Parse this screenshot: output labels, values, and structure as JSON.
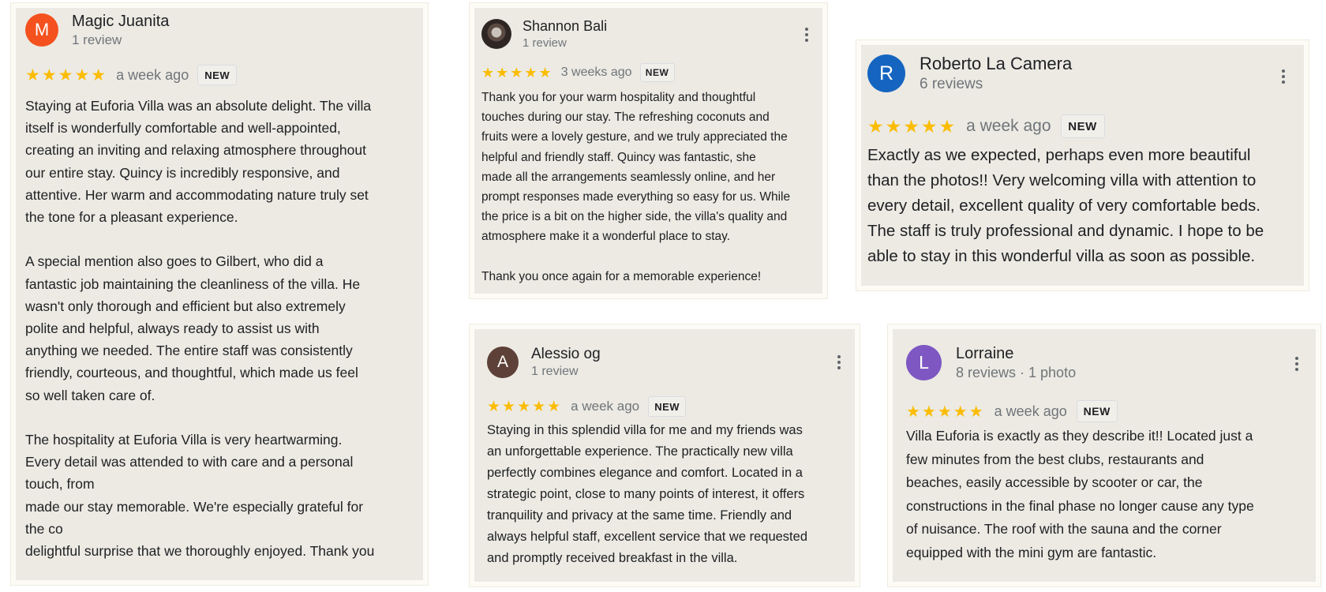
{
  "colors": {
    "card_bg": "#eceae3",
    "star": "#fbbc04",
    "meta_text": "#70757a",
    "avatar_magic": "#f4511e",
    "avatar_roberto": "#1565c0",
    "avatar_alessio": "#5d4037",
    "avatar_lorraine": "#7e57c2"
  },
  "reviews": [
    {
      "avatar_letter": "M",
      "name": "Magic Juanita",
      "meta": "1 review",
      "rating": 5,
      "stars": "★★★★★",
      "time": "a week ago",
      "badge": "NEW",
      "text": "Staying at Euforia Villa was an absolute delight. The villa\nitself is wonderfully comfortable and well-appointed,\ncreating an inviting and relaxing atmosphere throughout\nour entire stay. Quincy is incredibly responsive, and\nattentive. Her warm and accommodating nature truly set\nthe tone for a pleasant experience.\n\nA special mention also goes to Gilbert, who did a\nfantastic job maintaining the cleanliness of the villa. He\nwasn't only thorough and efficient but also extremely\npolite and helpful, always ready to assist us with\nanything we needed. The entire staff was consistently\nfriendly, courteous, and thoughtful, which made us feel\nso well taken care of.\n\nThe hospitality at Euforia Villa is very heartwarming.\nEvery detail was attended to with care and a personal\ntouch, from\nmade our stay memorable. We're especially grateful for\nthe co\ndelightful surprise that we thoroughly enjoyed. Thank you"
    },
    {
      "avatar_icon": "profile-photo",
      "name": "Shannon Bali",
      "meta": "1 review",
      "rating": 5,
      "stars": "★★★★★",
      "time": "3 weeks ago",
      "badge": "NEW",
      "text": "Thank you for your warm hospitality and thoughtful\ntouches during our stay. The refreshing coconuts and\nfruits were a lovely gesture, and we truly appreciated the\nhelpful and friendly staff. Quincy was fantastic, she\nmade all the arrangements seamlessly online, and her\nprompt responses made everything so easy for us. While\nthe price is a bit on the higher side, the villa's quality and\natmosphere make it a wonderful place to stay.\n\nThank you once again for a memorable experience!"
    },
    {
      "avatar_letter": "R",
      "name": "Roberto La Camera",
      "meta": "6 reviews",
      "rating": 5,
      "stars": "★★★★★",
      "time": "a week ago",
      "badge": "NEW",
      "text": "Exactly as we expected, perhaps even more beautiful\nthan the photos!! Very welcoming villa with attention to\nevery detail, excellent quality of very comfortable beds.\nThe staff is truly professional and dynamic. I hope to be\nable to stay in this wonderful villa as soon as possible."
    },
    {
      "avatar_letter": "A",
      "name": "Alessio og",
      "meta": "1 review",
      "rating": 5,
      "stars": "★★★★★",
      "time": "a week ago",
      "badge": "NEW",
      "text": "Staying in this splendid villa for me and my friends was\nan unforgettable experience. The practically new villa\nperfectly combines elegance and comfort. Located in a\nstrategic point, close to many points of interest, it offers\ntranquility and privacy at the same time. Friendly and\nalways helpful staff, excellent service that we requested\nand promptly received breakfast in the villa."
    },
    {
      "avatar_letter": "L",
      "name": "Lorraine",
      "meta": "8 reviews · 1 photo",
      "rating": 5,
      "stars": "★★★★★",
      "time": "a week ago",
      "badge": "NEW",
      "text": "Villa Euforia is exactly as they describe it!! Located just a\nfew minutes from the best clubs, restaurants and\nbeaches, easily accessible by scooter or car, the\nconstructions in the final phase no longer cause any type\nof nuisance. The roof with the sauna and the corner\nequipped with the mini gym are fantastic."
    }
  ]
}
